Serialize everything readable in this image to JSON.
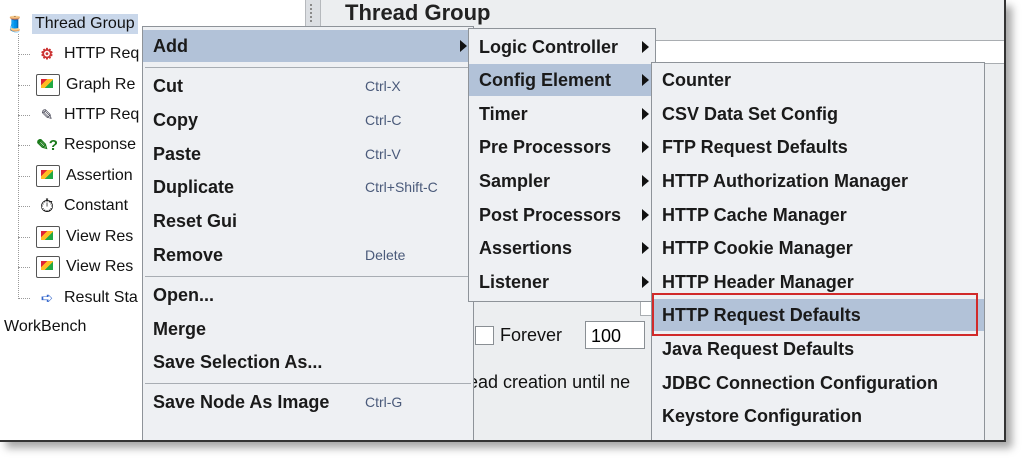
{
  "tree": {
    "root_label": "Thread Group",
    "items": [
      {
        "label": "HTTP Req",
        "icon": "http-sampler-icon"
      },
      {
        "label": "Graph Re",
        "icon": "graph-results-icon"
      },
      {
        "label": "HTTP Req",
        "icon": "http-header-pipette-icon"
      },
      {
        "label": "Response",
        "icon": "response-assertion-icon"
      },
      {
        "label": "Assertion",
        "icon": "assertion-results-icon"
      },
      {
        "label": "Constant",
        "icon": "timer-clock-icon"
      },
      {
        "label": "View Res",
        "icon": "view-results-icon"
      },
      {
        "label": "View Res",
        "icon": "view-results-icon"
      },
      {
        "label": "Result Sta",
        "icon": "result-status-icon"
      }
    ],
    "workbench_label": "WorkBench"
  },
  "panel": {
    "title": "Thread Group",
    "forever_label": "Forever",
    "loop_count": "100",
    "delay_text": "ead creation until ne"
  },
  "context_menu": {
    "items": [
      {
        "label": "Add",
        "shortcut": "",
        "has_submenu": true
      },
      {
        "label": "Cut",
        "shortcut": "Ctrl-X"
      },
      {
        "label": "Copy",
        "shortcut": "Ctrl-C"
      },
      {
        "label": "Paste",
        "shortcut": "Ctrl-V"
      },
      {
        "label": "Duplicate",
        "shortcut": "Ctrl+Shift-C"
      },
      {
        "label": "Reset Gui",
        "shortcut": ""
      },
      {
        "label": "Remove",
        "shortcut": "Delete"
      },
      {
        "label": "Open...",
        "shortcut": ""
      },
      {
        "label": "Merge",
        "shortcut": ""
      },
      {
        "label": "Save Selection As...",
        "shortcut": ""
      },
      {
        "label": "Save Node As Image",
        "shortcut": "Ctrl-G"
      }
    ]
  },
  "add_submenu": {
    "items": [
      {
        "label": "Logic Controller"
      },
      {
        "label": "Config Element"
      },
      {
        "label": "Timer"
      },
      {
        "label": "Pre Processors"
      },
      {
        "label": "Sampler"
      },
      {
        "label": "Post Processors"
      },
      {
        "label": "Assertions"
      },
      {
        "label": "Listener"
      }
    ]
  },
  "config_submenu": {
    "items": [
      {
        "label": "Counter"
      },
      {
        "label": "CSV Data Set Config"
      },
      {
        "label": "FTP Request Defaults"
      },
      {
        "label": "HTTP Authorization Manager"
      },
      {
        "label": "HTTP Cache Manager"
      },
      {
        "label": "HTTP Cookie Manager"
      },
      {
        "label": "HTTP Header Manager"
      },
      {
        "label": "HTTP Request Defaults"
      },
      {
        "label": "Java Request Defaults"
      },
      {
        "label": "JDBC Connection Configuration"
      },
      {
        "label": "Keystore Configuration"
      }
    ],
    "highlighted_item": "HTTP Request Defaults",
    "highlight_color": "#d12a2a"
  },
  "colors": {
    "menu_background": "#eef0f3",
    "active_item": "#b2c2d8",
    "tree_selection": "#c9d7ea"
  }
}
